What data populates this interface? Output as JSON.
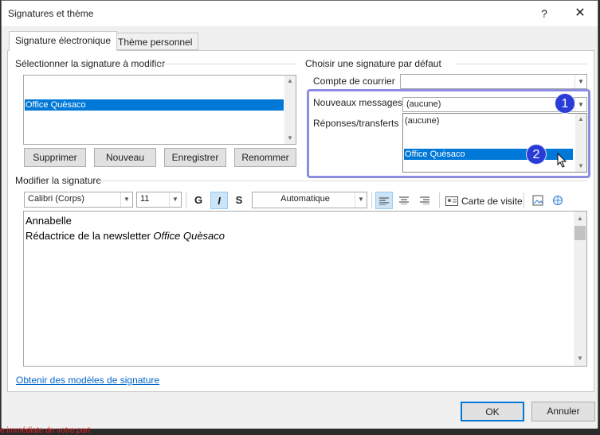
{
  "window": {
    "title": "Signatures et thème",
    "help": "?",
    "close": "✕"
  },
  "tabs": [
    {
      "label": "Signature électronique"
    },
    {
      "label": "Thème personnel"
    }
  ],
  "left": {
    "section": "Sélectionner la signature à modifier",
    "signatures": [
      "Office Quèsaco"
    ],
    "buttons": {
      "delete": "Supprimer",
      "new": "Nouveau",
      "save": "Enregistrer",
      "rename": "Renommer"
    }
  },
  "right": {
    "section": "Choisir une signature par défaut",
    "account_label": "Compte de courrier",
    "account_value": "",
    "new_messages_label": "Nouveaux messages :",
    "new_messages_value": "(aucune)",
    "replies_label": "Réponses/transferts :",
    "dropdown_options": [
      "(aucune)",
      "Office Quèsaco"
    ],
    "dropdown_selected": "Office Quèsaco"
  },
  "badges": {
    "one": "1",
    "two": "2"
  },
  "edit": {
    "section": "Modifier la signature",
    "font": "Calibri (Corps)",
    "size": "11",
    "bold": "G",
    "italic": "I",
    "strike": "S",
    "color": "Automatique",
    "business_card": "Carte de visite",
    "lines": [
      "Annabelle",
      "Rédactrice de la newsletter ",
      "Office Quèsaco"
    ]
  },
  "link": "Obtenir des modèles de signature",
  "footer": {
    "ok": "OK",
    "cancel": "Annuler"
  },
  "bottom_text": "e immédiate de votre part",
  "colors": {
    "accent": "#0078d7",
    "highlight": "#8c8ce0",
    "badge": "#2a3cd6"
  }
}
